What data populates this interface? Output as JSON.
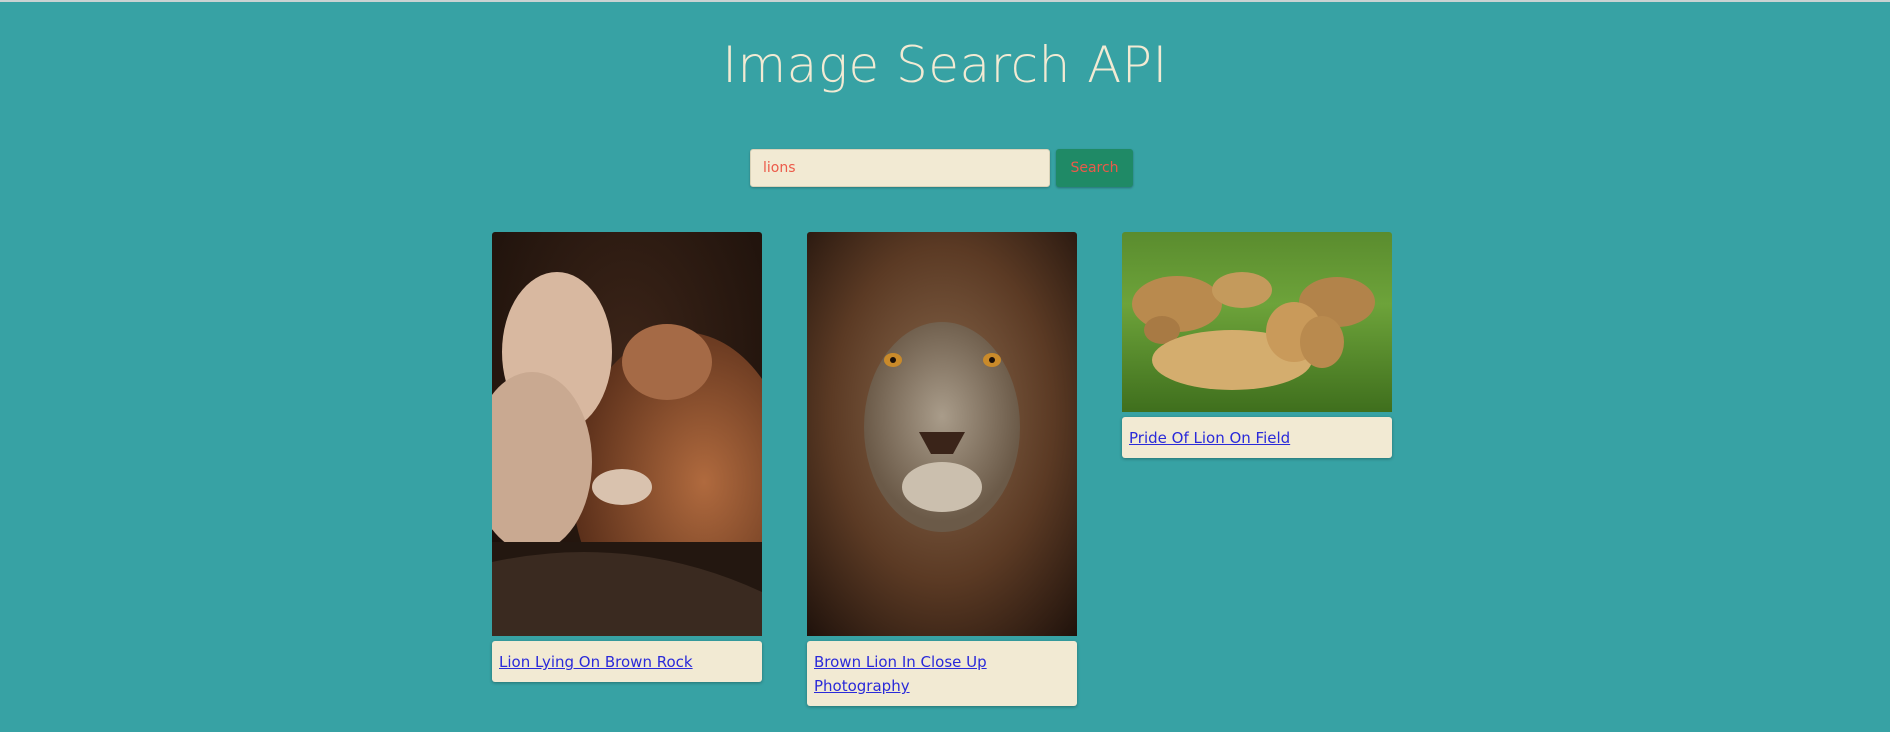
{
  "page": {
    "title": "Image Search API",
    "background_color": "#37a2a4"
  },
  "search": {
    "value": "lions",
    "button_label": "Search"
  },
  "results": [
    {
      "caption": "Lion Lying On Brown Rock",
      "image": "lion-and-lioness-photo"
    },
    {
      "caption": "Brown Lion In Close Up Photography",
      "image": "lion-face-closeup-photo"
    },
    {
      "caption": "Pride Of Lion On Field",
      "image": "lion-pride-on-grass-photo"
    }
  ],
  "colors": {
    "title": "#f2ead3",
    "input_background": "#f2ead3",
    "input_text": "#ec5a49",
    "button_background": "#1f8a66",
    "button_text": "#ec5a49",
    "link": "#2a2ad9"
  }
}
